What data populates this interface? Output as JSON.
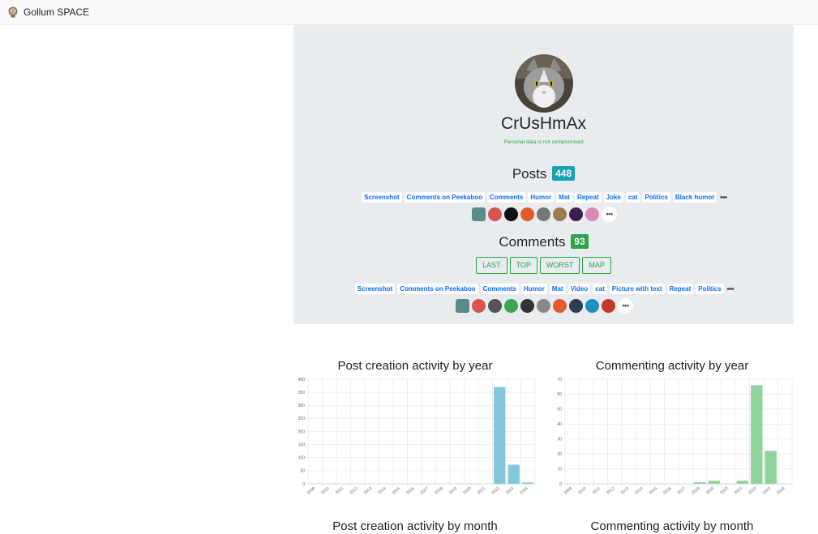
{
  "app": {
    "title": "Gollum SPACE"
  },
  "profile": {
    "username": "CrUsHmAx",
    "privacy_note": "Personal data is not compromised"
  },
  "posts": {
    "label": "Posts",
    "count": "448",
    "tags": [
      "Screenshot",
      "Comments on Peekaboo",
      "Comments",
      "Humor",
      "Mat",
      "Repeat",
      "Joke",
      "cat",
      "Politics",
      "Black humor"
    ],
    "more": "•••",
    "community_icons": [
      "#5b8a8a",
      "#d9534f",
      "#111111",
      "#e05a2b",
      "#777777",
      "#9a7b4f",
      "#3b1f4a",
      "#d88ab5"
    ]
  },
  "comments": {
    "label": "Comments",
    "count": "93",
    "buttons": [
      "LAST",
      "TOP",
      "WORST",
      "MAP"
    ],
    "tags": [
      "Screenshot",
      "Comments on Peekaboo",
      "Comments",
      "Humor",
      "Mat",
      "Video",
      "cat",
      "Picture with text",
      "Repeat",
      "Politics"
    ],
    "more": "•••",
    "community_icons": [
      "#5b8a8a",
      "#d9534f",
      "#555555",
      "#3aa655",
      "#333333",
      "#888888",
      "#e05a2b",
      "#2c3e50",
      "#1e90c0",
      "#c0392b"
    ]
  },
  "charts": {
    "posts_year_title": "Post creation activity by year",
    "comments_year_title": "Commenting activity by year",
    "posts_month_title": "Post creation activity by month",
    "comments_month_title": "Commenting activity by month"
  },
  "chart_data": [
    {
      "type": "bar",
      "title": "Post creation activity by year",
      "categories": [
        "2009",
        "2010",
        "2011",
        "2012",
        "2013",
        "2014",
        "2015",
        "2016",
        "2017",
        "2018",
        "2019",
        "2020",
        "2021",
        "2022",
        "2023",
        "2024"
      ],
      "values": [
        0,
        0,
        0,
        0,
        0,
        0,
        0,
        0,
        0,
        0,
        0,
        0,
        0,
        370,
        73,
        5
      ],
      "yticks": [
        0,
        50,
        100,
        150,
        200,
        250,
        300,
        350,
        400
      ],
      "ylim": [
        0,
        400
      ],
      "color": "#86c7dc",
      "grid": true
    },
    {
      "type": "bar",
      "title": "Commenting activity by year",
      "categories": [
        "2009",
        "2010",
        "2011",
        "2012",
        "2013",
        "2014",
        "2015",
        "2016",
        "2017",
        "2018",
        "2019",
        "2020",
        "2021",
        "2022",
        "2023",
        "2024"
      ],
      "values": [
        0,
        0,
        0,
        0,
        0,
        0,
        0,
        0,
        0,
        1,
        2,
        0,
        2,
        66,
        22,
        0
      ],
      "yticks": [
        0,
        10,
        20,
        30,
        40,
        50,
        60,
        70
      ],
      "ylim": [
        0,
        70
      ],
      "color": "#8fd49b",
      "grid": true
    }
  ]
}
